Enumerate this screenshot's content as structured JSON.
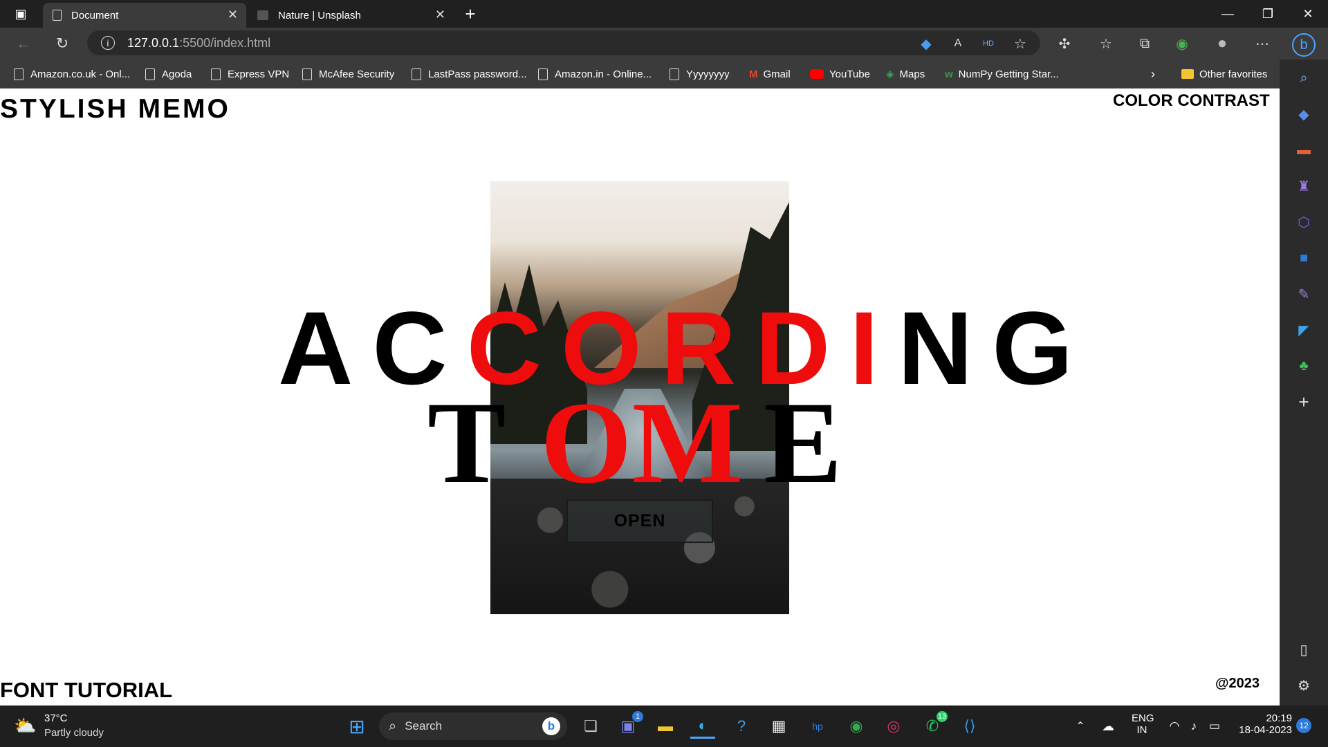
{
  "browser": {
    "tabs": [
      {
        "label": "Document"
      },
      {
        "label": "Nature | Unsplash"
      }
    ],
    "address": {
      "host": "127.0.0.1",
      "rest": ":5500/index.html"
    },
    "bookmarks": [
      {
        "label": "Amazon.co.uk - Onl..."
      },
      {
        "label": "Agoda"
      },
      {
        "label": "Express VPN"
      },
      {
        "label": "McAfee Security"
      },
      {
        "label": "LastPass password..."
      },
      {
        "label": "Amazon.in - Online..."
      },
      {
        "label": "Yyyyyyyy"
      },
      {
        "label": "Gmail"
      },
      {
        "label": "YouTube"
      },
      {
        "label": "Maps"
      },
      {
        "label": "NumPy Getting Star..."
      }
    ],
    "other_favorites": "Other favorites"
  },
  "page": {
    "logo": "STYLISH MEMO",
    "nav_right": "COLOR CONTRAST",
    "headline_line1": {
      "pre": "AC",
      "red": "CORDI",
      "post": "NG"
    },
    "headline_line2": {
      "pre": "T",
      "red": "OM",
      "post": "E"
    },
    "open_button": "OPEN",
    "footer_left": "FONT TUTORIAL",
    "footer_right": "@2023"
  },
  "taskbar": {
    "weather_temp": "37°C",
    "weather_desc": "Partly cloudy",
    "search_label": "Search",
    "lang": "ENG",
    "region": "IN",
    "time": "20:19",
    "date": "18-04-2023",
    "teams_badge": "1",
    "whatsapp_badge": "13",
    "notif_count": "12"
  },
  "colors": {
    "accent_red": "#ef0c0c",
    "chrome_dark": "#202020",
    "chrome_mid": "#3b3b3b"
  }
}
